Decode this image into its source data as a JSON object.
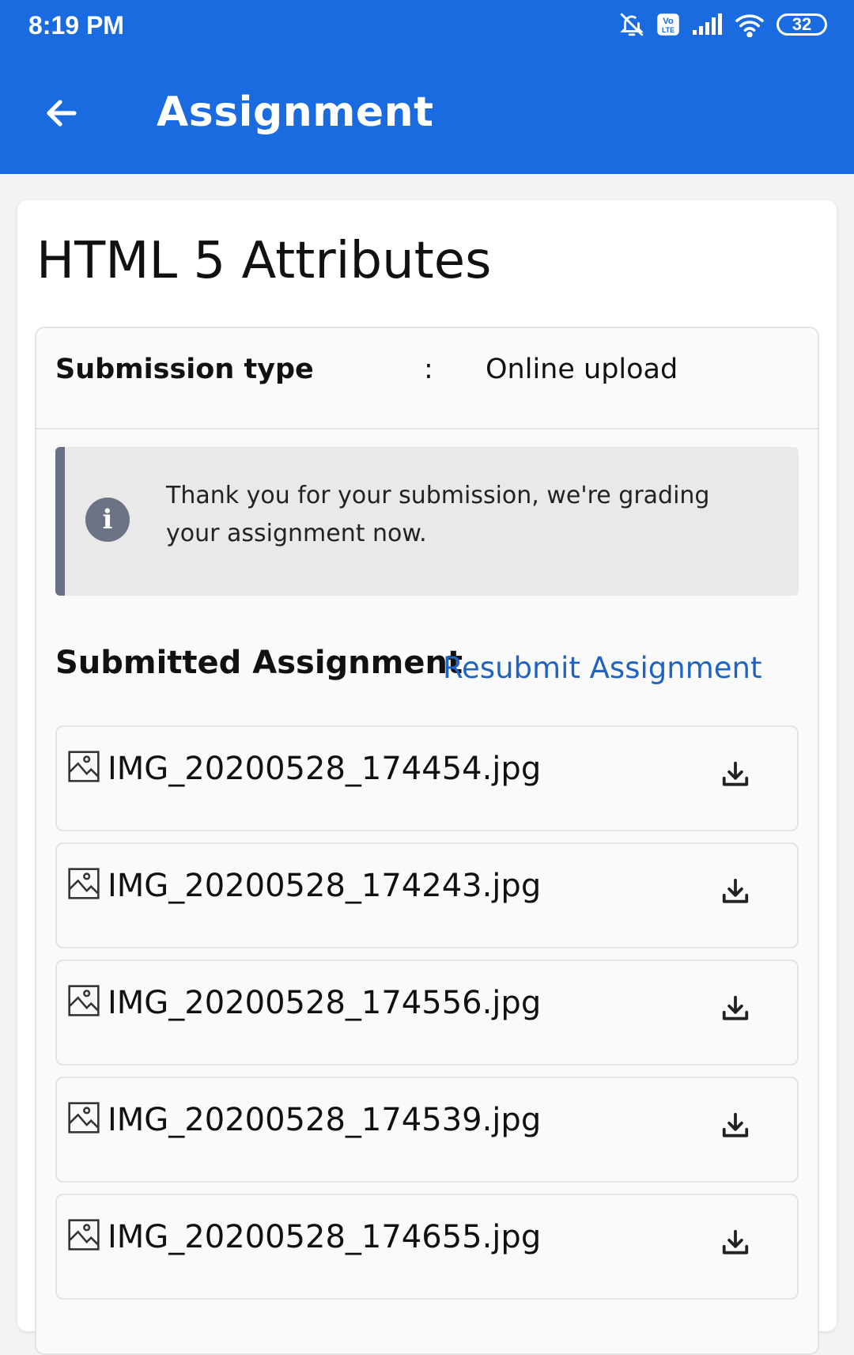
{
  "status_bar": {
    "time": "8:19 PM",
    "battery": "32",
    "icons": [
      "bell-off-icon",
      "volte-icon",
      "signal-icon",
      "wifi-icon",
      "battery-icon"
    ]
  },
  "app_bar": {
    "back_icon": "arrow-left-icon",
    "title": "Assignment"
  },
  "assignment": {
    "title": "HTML 5 Attributes",
    "submission_type_label": "Submission type",
    "separator": ":",
    "submission_type_value": "Online upload",
    "notice": {
      "icon": "info-icon",
      "icon_glyph": "i",
      "text": "Thank you for your submission, we're grading your assignment now."
    },
    "submitted_heading": "Submitted Assignment",
    "resubmit_label": "Resubmit Assignment",
    "files": [
      {
        "name": "IMG_20200528_174454.jpg"
      },
      {
        "name": "IMG_20200528_174243.jpg"
      },
      {
        "name": "IMG_20200528_174556.jpg"
      },
      {
        "name": "IMG_20200528_174539.jpg"
      },
      {
        "name": "IMG_20200528_174655.jpg"
      }
    ]
  },
  "colors": {
    "app_bar": "#1a6be0",
    "link": "#1f64c4",
    "notice_bg": "#e9e9e9",
    "notice_border": "#677183"
  }
}
